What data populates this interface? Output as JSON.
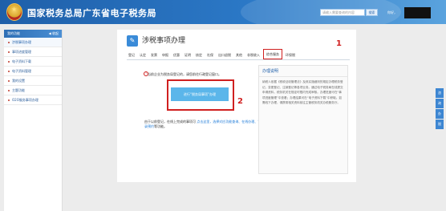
{
  "header": {
    "site_title": "国家税务总局广东省电子税务局",
    "search_placeholder": "请输入需要查询的内容",
    "search_label": "搜索",
    "user_prefix": "你好，"
  },
  "sidebar": {
    "title": "我的功能",
    "collapse_label": "◀ 收起",
    "items": [
      {
        "label": "涉税事项办理"
      },
      {
        "label": "事项进度管理"
      },
      {
        "label": "电子资料下载"
      },
      {
        "label": "电子资料管理"
      },
      {
        "label": "我的设置"
      },
      {
        "label": "主题功能"
      },
      {
        "label": "O2O服务事项办理"
      }
    ]
  },
  "main": {
    "icon_glyph": "✎",
    "page_title": "涉税事项办理",
    "tabs": [
      {
        "label": "登记"
      },
      {
        "label": "认定"
      },
      {
        "label": "发票"
      },
      {
        "label": "申报"
      },
      {
        "label": "优惠"
      },
      {
        "label": "证明"
      },
      {
        "label": "核定"
      },
      {
        "label": "社保"
      },
      {
        "label": "出口退税"
      },
      {
        "label": "其他"
      },
      {
        "label": "非税收入"
      },
      {
        "label": "综合服务"
      },
      {
        "label": "环保税"
      }
    ],
    "notice_icon": "!",
    "notice": "当前企业为税务局登记的，请您前往行政登记窗口。",
    "enter_button": "进行“税务局事项”办理",
    "tip_text": "由于以前登记，在线上完成的事项可 ",
    "tip_link": "点击这里，选择对应功能查询、在线办理、记录预约",
    "tip_tail": "等功能。",
    "annotation_1": "1",
    "annotation_2": "2"
  },
  "side_panel": {
    "title": "办理说明",
    "body": "纳税人依据《税收征收管理法》及其实施细则的规定办理税务登记、变更登记、注销登记等各项业务。通过电子税务局在线提交申请资料，税务机关在规定时限内完成审核。办理进度可在“事项进度管理”中查看；办理结果可在“电子资料下载”中获取。如需线下办理，请携带相关资料前往主管税务机关办税服务厅。"
  },
  "float_bar": [
    {
      "label": "咨"
    },
    {
      "label": "询"
    },
    {
      "label": "办"
    },
    {
      "label": "税"
    }
  ],
  "colors": {
    "header_blue": "#1f5fa9",
    "annotation_red": "#d02020",
    "button_blue": "#5bb6ea"
  }
}
